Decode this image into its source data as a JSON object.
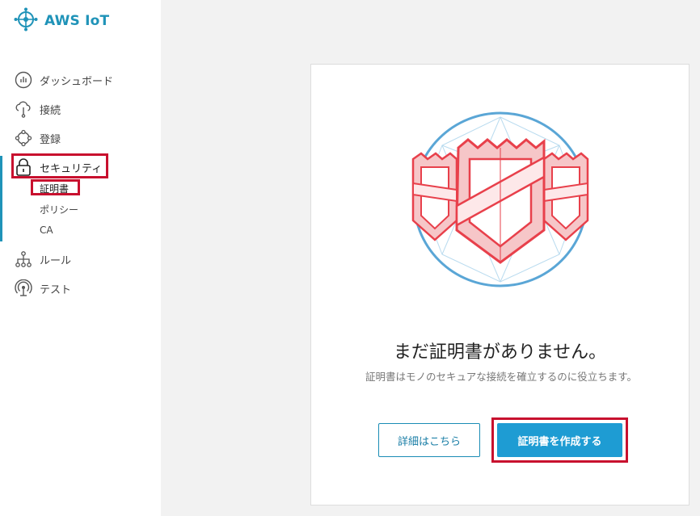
{
  "app": {
    "logo_text": "AWS IoT",
    "logo_icon": "aws-iot-icon"
  },
  "sidebar": {
    "items": [
      {
        "label": "ダッシュボード",
        "icon": "dashboard-icon"
      },
      {
        "label": "接続",
        "icon": "cloud-connect-icon"
      },
      {
        "label": "登録",
        "icon": "register-icon"
      },
      {
        "label": "セキュリティ",
        "icon": "lock-icon"
      },
      {
        "label": "ルール",
        "icon": "rules-icon"
      },
      {
        "label": "テスト",
        "icon": "test-icon"
      }
    ],
    "security_subitems": [
      {
        "label": "証明書"
      },
      {
        "label": "ポリシー"
      },
      {
        "label": "CA"
      }
    ]
  },
  "empty_state": {
    "title": "まだ証明書がありません。",
    "description": "証明書はモノのセキュアな接続を確立するのに役立ちます。",
    "secondary_button": "詳細はこちら",
    "primary_button": "証明書を作成する"
  },
  "colors": {
    "accent": "#1f93b8",
    "primary_button": "#1e9cd3",
    "highlight": "#c8102e",
    "shield": "#e8404b"
  }
}
